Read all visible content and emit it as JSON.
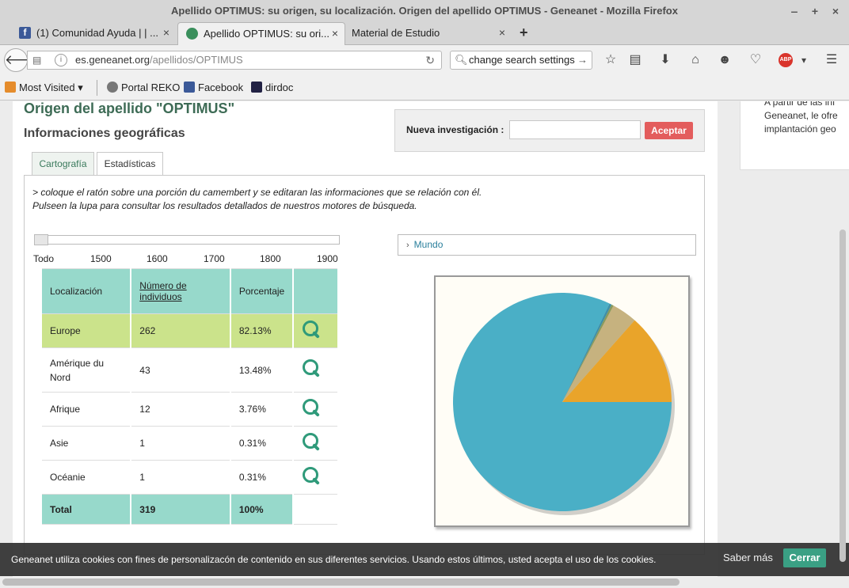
{
  "window": {
    "title": "Apellido OPTIMUS: su origen, su localización. Origen del apellido OPTIMUS - Geneanet - Mozilla Firefox",
    "controls": [
      "+",
      "+",
      "×"
    ]
  },
  "tabs": [
    {
      "label": "(1) Comunidad Ayuda | | ...",
      "icon": "facebook-icon"
    },
    {
      "label": "Apellido OPTIMUS: su ori...",
      "icon": "geneanet-icon",
      "active": true
    },
    {
      "label": "Material de Estudio"
    }
  ],
  "tab_close": "×",
  "new_tab": "+",
  "urlbar": {
    "domain": "es.geneanet.org",
    "path": "/apellidos/OPTIMUS"
  },
  "searchbar": {
    "value": "change search settings"
  },
  "bookmarks": [
    "Most Visited",
    "Portal REKO",
    "Facebook",
    "dirdoc"
  ],
  "page": {
    "title": "Origen del apellido \"OPTIMUS\"",
    "section": "Informaciones geográficas",
    "right_col": [
      "A partir de las inf",
      "Geneanet, le ofre",
      "implantación geo"
    ],
    "search": {
      "label": "Nueva investigación  :",
      "button": "Aceptar"
    },
    "tabs": [
      "Cartografía",
      "Estadísticas"
    ],
    "instructions": [
      "> coloque el ratón sobre una porción du camembert y se editaran las informaciones que se relación con él.",
      "Pulseen la lupa para consultar los resultados detallados de nuestros motores de búsqueda."
    ],
    "years": [
      "Todo",
      "1500",
      "1600",
      "1700",
      "1800",
      "1900"
    ],
    "table": {
      "headers": [
        "Localización",
        "Número de individuos",
        "Porcentaje"
      ],
      "rows": [
        {
          "loc": "Europe",
          "n": "262",
          "pct": "82.13%"
        },
        {
          "loc": "Amérique du Nord",
          "n": "43",
          "pct": "13.48%"
        },
        {
          "loc": "Afrique",
          "n": "12",
          "pct": "3.76%"
        },
        {
          "loc": "Asie",
          "n": "1",
          "pct": "0.31%"
        },
        {
          "loc": "Océanie",
          "n": "1",
          "pct": "0.31%"
        }
      ],
      "total": {
        "label": "Total",
        "n": "319",
        "pct": "100%"
      }
    },
    "mundo": "Mundo"
  },
  "chart_data": {
    "type": "pie",
    "categories": [
      "Europe",
      "Amérique du Nord",
      "Afrique",
      "Asie",
      "Océanie"
    ],
    "values": [
      262,
      43,
      12,
      1,
      1
    ],
    "colors": [
      "#4aafc6",
      "#e9a42a",
      "#c6b27f",
      "#8a9a5b",
      "#3d8fa8"
    ]
  },
  "cookie": {
    "text": "Geneanet utiliza cookies con fines de personalizacón de contenido en sus diferentes servicios. Usando estos últimos, usted acepta el uso de los cookies.",
    "more": "Saber más",
    "close": "Cerrar"
  }
}
